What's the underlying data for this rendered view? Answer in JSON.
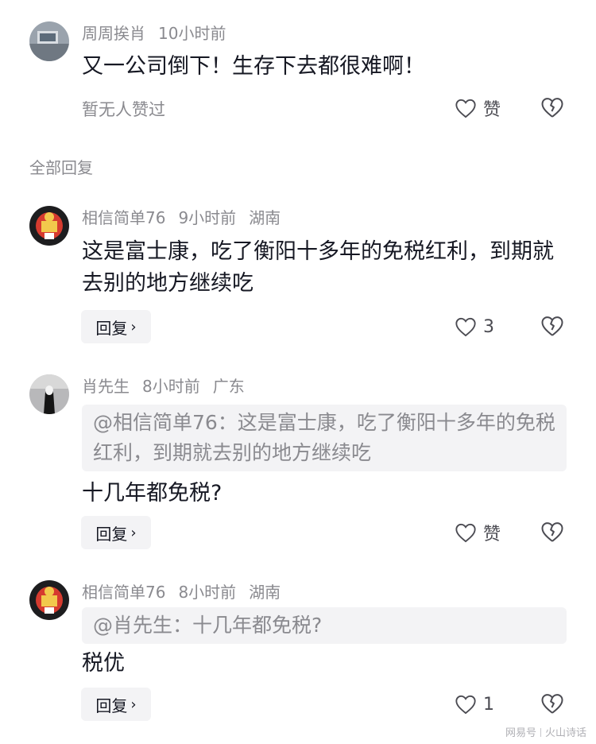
{
  "top_comment": {
    "author": "周周挨肖",
    "time": "10小时前",
    "text": "又一公司倒下！生存下去都很难啊！",
    "no_likes": "暂无人赞过",
    "like_label": "赞"
  },
  "section_label": "全部回复",
  "replies": [
    {
      "author": "相信简单76",
      "time": "9小时前",
      "location": "湖南",
      "text": "这是富士康，吃了衡阳十多年的免税红利，到期就去别的地方继续吃",
      "reply_label": "回复",
      "likes": "3"
    },
    {
      "author": "肖先生",
      "time": "8小时前",
      "location": "广东",
      "quote": "@相信简单76：这是富士康，吃了衡阳十多年的免税红利，到期就去别的地方继续吃",
      "text": "十几年都免税?",
      "reply_label": "回复",
      "likes": "赞"
    },
    {
      "author": "相信简单76",
      "time": "8小时前",
      "location": "湖南",
      "quote": "@肖先生：十几年都免税?",
      "text": "税优",
      "reply_label": "回复",
      "likes": "1"
    }
  ],
  "watermark": {
    "left": "网易号",
    "right": "火山诗话"
  },
  "colors": {
    "meta": "#8a8a8f",
    "text": "#161823",
    "button_bg": "#f3f3f5"
  }
}
